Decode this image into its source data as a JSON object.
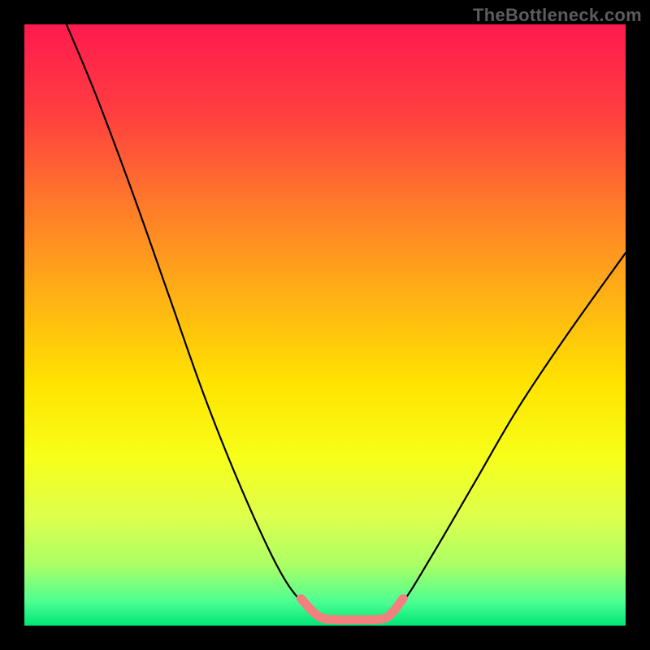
{
  "watermark": "TheBottleneck.com",
  "chart_data": {
    "type": "line",
    "title": "",
    "xlabel": "",
    "ylabel": "",
    "xlim": [
      0,
      100
    ],
    "ylim": [
      0,
      100
    ],
    "grid": false,
    "legend": false,
    "background": {
      "type": "vertical-gradient",
      "stops": [
        {
          "pos": 0.0,
          "color": "#ff1a4f"
        },
        {
          "pos": 0.15,
          "color": "#ff3f3f"
        },
        {
          "pos": 0.3,
          "color": "#ff7a2a"
        },
        {
          "pos": 0.45,
          "color": "#ffb015"
        },
        {
          "pos": 0.6,
          "color": "#ffe400"
        },
        {
          "pos": 0.72,
          "color": "#f7ff1a"
        },
        {
          "pos": 0.82,
          "color": "#ddff4d"
        },
        {
          "pos": 0.9,
          "color": "#aaff66"
        },
        {
          "pos": 0.96,
          "color": "#4dff93"
        },
        {
          "pos": 1.0,
          "color": "#00e676"
        }
      ]
    },
    "series": [
      {
        "name": "bottleneck-curve",
        "points": [
          {
            "x": 7,
            "y": 100
          },
          {
            "x": 12,
            "y": 88
          },
          {
            "x": 18,
            "y": 72
          },
          {
            "x": 24,
            "y": 55
          },
          {
            "x": 30,
            "y": 38
          },
          {
            "x": 36,
            "y": 23
          },
          {
            "x": 42,
            "y": 10
          },
          {
            "x": 46,
            "y": 4
          },
          {
            "x": 49,
            "y": 1.5
          },
          {
            "x": 53,
            "y": 1
          },
          {
            "x": 57,
            "y": 1
          },
          {
            "x": 60,
            "y": 1.5
          },
          {
            "x": 63,
            "y": 4
          },
          {
            "x": 68,
            "y": 12
          },
          {
            "x": 75,
            "y": 24
          },
          {
            "x": 82,
            "y": 36
          },
          {
            "x": 90,
            "y": 48
          },
          {
            "x": 100,
            "y": 62
          }
        ]
      },
      {
        "name": "highlight-band",
        "color": "#f2807e",
        "points": [
          {
            "x": 46,
            "y": 4.5
          },
          {
            "x": 49,
            "y": 1.5
          },
          {
            "x": 52,
            "y": 1
          },
          {
            "x": 55,
            "y": 1
          },
          {
            "x": 58,
            "y": 1
          },
          {
            "x": 60.5,
            "y": 1.5
          },
          {
            "x": 63,
            "y": 4.5
          }
        ]
      }
    ]
  }
}
